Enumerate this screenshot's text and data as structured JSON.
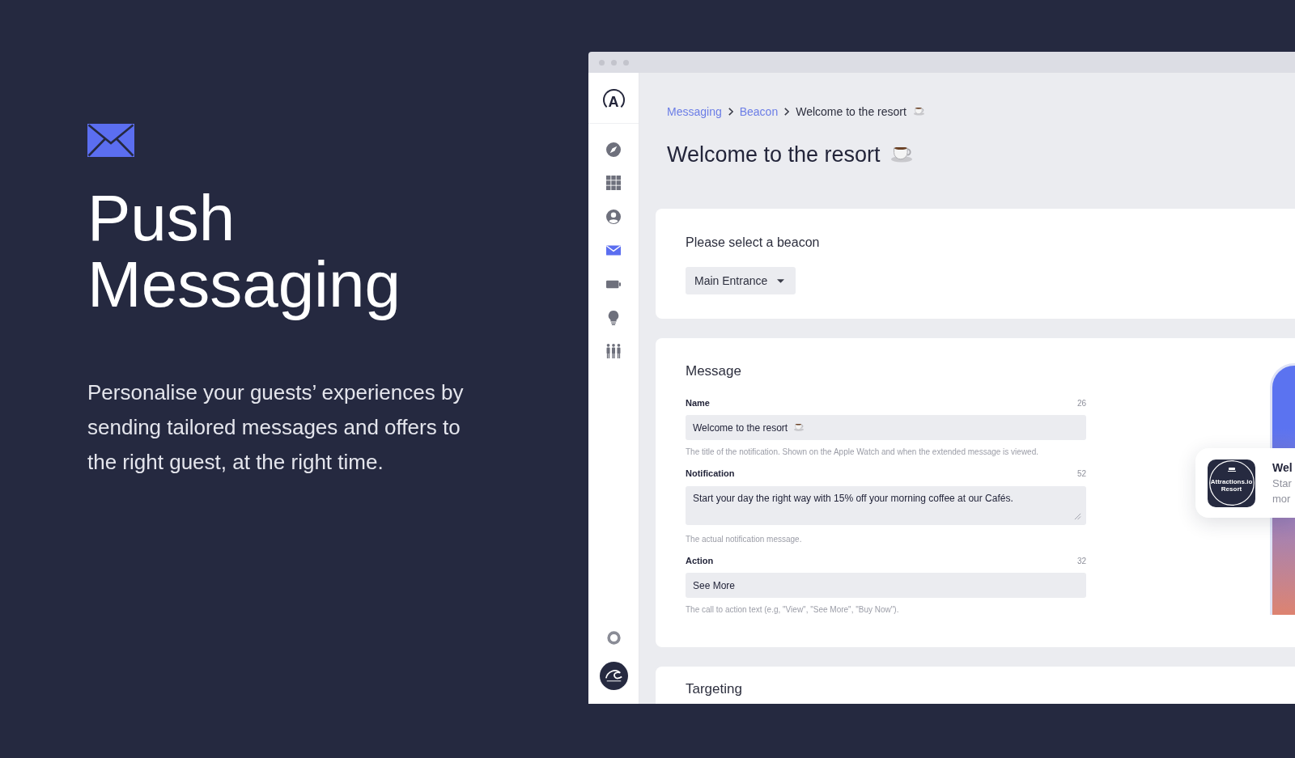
{
  "hero": {
    "title": "Push Messaging",
    "description": "Personalise your guests’ experiences by sending tailored messages and offers to the right guest, at the right time."
  },
  "sidebar": {
    "logo": "A",
    "items": [
      {
        "kind": "compass",
        "selected": false
      },
      {
        "kind": "grid",
        "selected": false
      },
      {
        "kind": "user",
        "selected": false
      },
      {
        "kind": "mail",
        "selected": true
      },
      {
        "kind": "battery",
        "selected": false
      },
      {
        "kind": "bulb",
        "selected": false
      },
      {
        "kind": "people",
        "selected": false
      }
    ],
    "footer_items": [
      {
        "kind": "help"
      },
      {
        "kind": "account"
      }
    ]
  },
  "breadcrumb": [
    {
      "label": "Messaging",
      "kind": "link",
      "emoji": false
    },
    {
      "label": "Beacon",
      "kind": "link",
      "emoji": false
    },
    {
      "label": "Welcome to the resort",
      "kind": "current",
      "emoji": true
    }
  ],
  "page_title": {
    "text": "Welcome to the resort",
    "emoji": true
  },
  "beacon_card": {
    "heading": "Please select a beacon",
    "dropdown": {
      "value": "Main Entrance"
    }
  },
  "message_card": {
    "heading": "Message",
    "fields": [
      {
        "kind": "input",
        "label": "Name",
        "count": "26",
        "value": "Welcome to the resort",
        "emoji": true,
        "help": "The title of the notification. Shown on the Apple Watch and when the extended message is viewed."
      },
      {
        "kind": "textarea",
        "label": "Notification",
        "count": "52",
        "value": "Start your day the right way with 15% off your morning coffee at our Cafés.",
        "emoji": false,
        "help": "The actual notification message."
      },
      {
        "kind": "input",
        "label": "Action",
        "count": "32",
        "value": "See More",
        "emoji": false,
        "help": "The call to action text (e.g, \"View\", \"See More\", \"Buy Now\")."
      }
    ]
  },
  "preview": {
    "app_icon_text": "Attractions.io Resort",
    "title": "Wel",
    "body_lines": [
      "Star",
      "mor"
    ]
  },
  "targeting_card": {
    "heading": "Targeting"
  }
}
